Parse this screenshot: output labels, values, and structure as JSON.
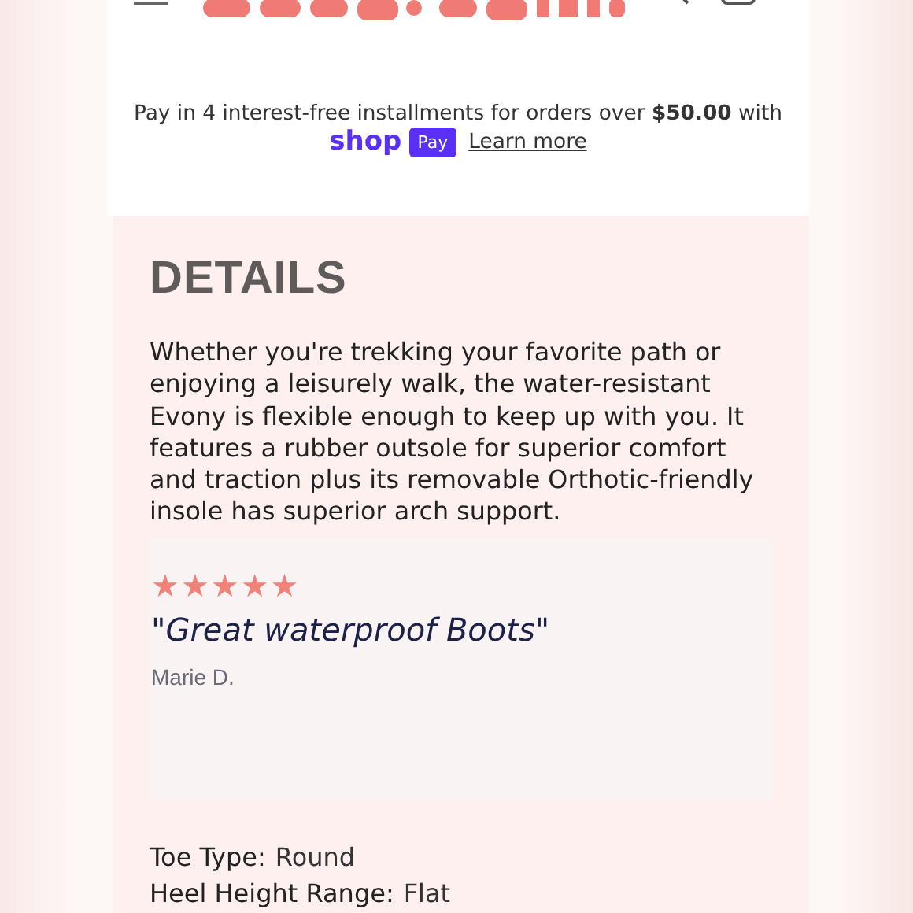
{
  "installments": {
    "text": "Pay in 4 interest-free installments for orders over **$50.00** with",
    "brand": "shop",
    "badge": "Pay",
    "link": "Learn more"
  },
  "details": {
    "heading": "DETAILS",
    "description": "Whether you're trekking your favorite path or enjoying a leisurely walk, the water-resistant Evony is flexible enough to keep up with you. It features a rubber outsole for superior comfort and traction plus its removable Orthotic-friendly insole has superior arch support.",
    "review": {
      "stars": 5,
      "title": "\"Great waterproof Boots\"",
      "author": "Marie D."
    },
    "specs": [
      {
        "label": "Toe Type:",
        "value": "Round"
      },
      {
        "label": "Heel Height Range:",
        "value": "Flat"
      }
    ]
  }
}
